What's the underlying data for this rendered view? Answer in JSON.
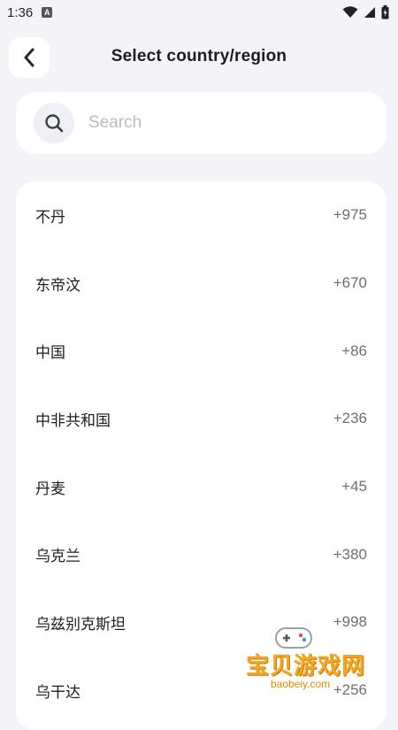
{
  "status_bar": {
    "time": "1:36",
    "notif_glyph": "A"
  },
  "header": {
    "title": "Select country/region"
  },
  "search": {
    "placeholder": "Search"
  },
  "countries": [
    {
      "name": "不丹",
      "code": "+975"
    },
    {
      "name": "东帝汶",
      "code": "+670"
    },
    {
      "name": "中国",
      "code": "+86"
    },
    {
      "name": "中非共和国",
      "code": "+236"
    },
    {
      "name": "丹麦",
      "code": "+45"
    },
    {
      "name": "乌克兰",
      "code": "+380"
    },
    {
      "name": "乌兹别克斯坦",
      "code": "+998"
    },
    {
      "name": "乌干达",
      "code": "+256"
    }
  ],
  "watermark": {
    "text": "宝贝游戏网",
    "url": "baobeiy.com"
  },
  "colors": {
    "background": "#f4f4f8",
    "card": "#ffffff",
    "accent_watermark": "#f5a623"
  }
}
